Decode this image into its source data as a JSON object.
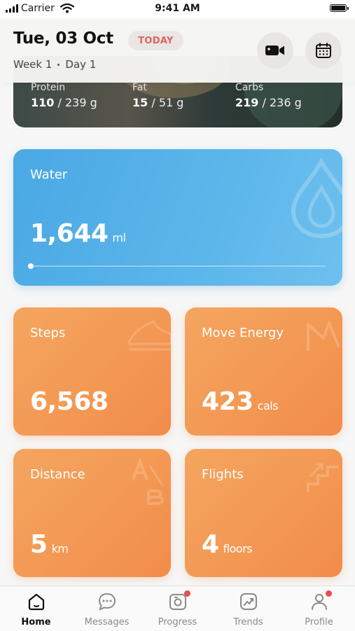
{
  "status_bar": {
    "carrier": "Carrier",
    "time": "9:41 AM"
  },
  "header": {
    "date": "Tue, 03 Oct",
    "today_badge": "TODAY",
    "week": "Week 1",
    "day": "Day 1",
    "buttons": [
      {
        "icon": "video-camera-icon"
      },
      {
        "icon": "calendar-icon"
      }
    ]
  },
  "nutrition": {
    "macros": [
      {
        "name": "Protein",
        "value": "110",
        "target": "/ 239 g"
      },
      {
        "name": "Fat",
        "value": "15",
        "target": "/ 51 g"
      },
      {
        "name": "Carbs",
        "value": "219",
        "target": "/ 236 g"
      }
    ]
  },
  "water": {
    "title": "Water",
    "value": "1,644",
    "unit": "ml",
    "progress": 0.0,
    "color": "#4aa8e4"
  },
  "metrics": {
    "steps": {
      "title": "Steps",
      "value": "6,568",
      "unit": ""
    },
    "move_energy": {
      "title": "Move Energy",
      "value": "423",
      "unit": "cals"
    },
    "distance": {
      "title": "Distance",
      "value": "5",
      "unit": "km"
    },
    "flights": {
      "title": "Flights",
      "value": "4",
      "unit": "floors"
    },
    "color": "#f39a55"
  },
  "tab_bar": {
    "items": [
      {
        "label": "Home",
        "icon": "home-icon",
        "active": true,
        "badge": false
      },
      {
        "label": "Messages",
        "icon": "chat-icon",
        "active": false,
        "badge": false
      },
      {
        "label": "Progress",
        "icon": "camera-icon",
        "active": false,
        "badge": true
      },
      {
        "label": "Trends",
        "icon": "trend-chart-icon",
        "active": false,
        "badge": false
      },
      {
        "label": "Profile",
        "icon": "profile-icon",
        "active": false,
        "badge": true
      }
    ],
    "badge_color": "#ef4b4b"
  }
}
